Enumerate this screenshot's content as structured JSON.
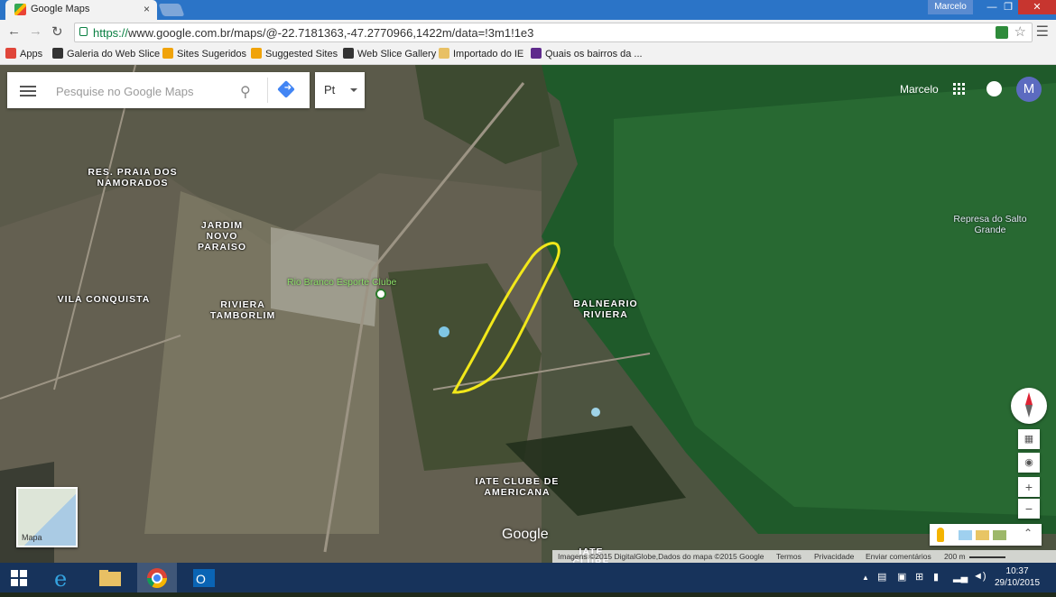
{
  "browser": {
    "tab_title": "Google Maps",
    "tab_close": "×",
    "user_name": "Marcelo",
    "url_scheme": "https://",
    "url_rest": "www.google.com.br/maps/@-22.7181363,-47.2770966,1422m/data=!3m1!1e3",
    "window_buttons": [
      "—",
      "❐",
      "✕"
    ]
  },
  "bookmarks": [
    {
      "label": "Apps",
      "icon_color": "#e0463a"
    },
    {
      "label": "Galeria do Web Slice",
      "icon_color": "#333333"
    },
    {
      "label": "Sites Sugeridos",
      "icon_color": "#f0a30a"
    },
    {
      "label": "Suggested Sites",
      "icon_color": "#f0a30a"
    },
    {
      "label": "Web Slice Gallery",
      "icon_color": "#333333"
    },
    {
      "label": "Importado do IE",
      "icon_color": "#e8c064"
    },
    {
      "label": "Quais os bairros da ...",
      "icon_color": "#5f2b8c"
    }
  ],
  "maps": {
    "search_placeholder": "Pesquise no Google Maps",
    "language": "Pt",
    "account_name": "Marcelo",
    "avatar_letter": "M",
    "minimap_label": "Mapa",
    "logo": "Google",
    "zoom_in": "+",
    "zoom_out": "−",
    "labels": {
      "res_praia": "RES. PRAIA DOS NAMORADOS",
      "jardim": "JARDIM NOVO PARAISO",
      "vila": "VILA CONQUISTA",
      "riviera": "RIVIERA TAMBORLIM",
      "balneario": "BALNEARIO RIVIERA",
      "iate": "IATE CLUBE DE AMERICANA",
      "iate_bottom": "IATE CLUBE",
      "represa": "Represa do Salto Grande",
      "poi": "Rio Branco Esporte Clube"
    },
    "attribution": {
      "imagery": "Imagens ©2015 DigitalGlobe,Dados do mapa ©2015 Google",
      "terms": "Termos",
      "privacy": "Privacidade",
      "feedback": "Enviar comentários",
      "scale": "200 m"
    }
  },
  "taskbar": {
    "time": "10:37",
    "date": "29/10/2015",
    "tray_arrow": "▲"
  }
}
